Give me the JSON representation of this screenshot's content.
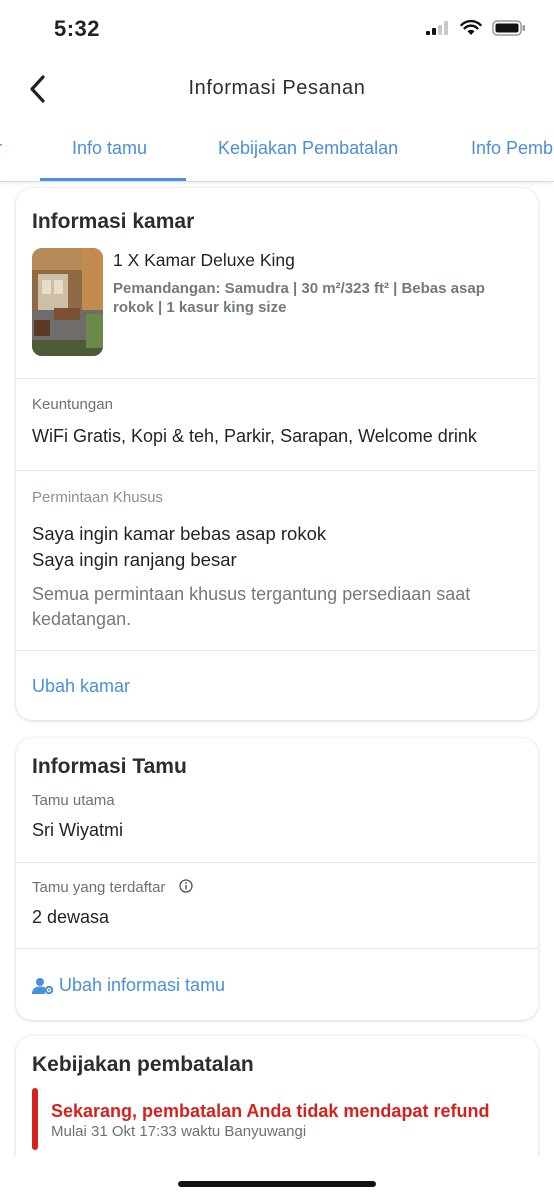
{
  "status_bar": {
    "time": "5:32",
    "icons": [
      "signal-icon",
      "wifi-icon",
      "battery-icon"
    ]
  },
  "nav": {
    "title": "Informasi Pesanan",
    "back_icon": "chevron-left-icon"
  },
  "tabs": [
    {
      "label": "r",
      "active": false
    },
    {
      "label": "Info tamu",
      "active": true
    },
    {
      "label": "Kebijakan Pembatalan",
      "active": false
    },
    {
      "label": "Info Pemb",
      "active": false
    }
  ],
  "room_info": {
    "title": "Informasi kamar",
    "room_name": "1 X Kamar Deluxe King",
    "room_desc": "Pemandangan: Samudra | 30 m²/323 ft² | Bebas asap rokok | 1 kasur king size",
    "benefits_label": "Keuntungan",
    "benefits": "WiFi Gratis, Kopi & teh, Parkir, Sarapan, Welcome drink",
    "special_label": "Permintaan Khusus",
    "requests": [
      "Saya ingin kamar bebas asap rokok",
      "Saya ingin ranjang besar"
    ],
    "note": "Semua permintaan khusus tergantung persediaan saat kedatangan.",
    "change_link": "Ubah kamar"
  },
  "guest_info": {
    "title": "Informasi Tamu",
    "main_guest_label": "Tamu utama",
    "main_guest": "Sri Wiyatmi",
    "registered_label": "Tamu yang terdaftar",
    "registered": "2 dewasa",
    "edit_link": "Ubah informasi tamu"
  },
  "cancellation": {
    "title": "Kebijakan pembatalan",
    "alert": "Sekarang, pembatalan Anda tidak mendapat refund",
    "sub": "Mulai 31 Okt 17:33 waktu Banyuwangi"
  },
  "colors": {
    "accent": "#4a8fd9",
    "alert": "#d4231e",
    "muted": "#737980"
  }
}
